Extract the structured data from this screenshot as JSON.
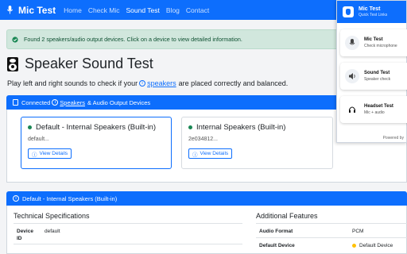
{
  "nav": {
    "brand": "Mic Test",
    "links": [
      {
        "label": "Home"
      },
      {
        "label": "Check Mic"
      },
      {
        "label": "Sound Test"
      },
      {
        "label": "Blog"
      },
      {
        "label": "Contact"
      }
    ],
    "active_index": 2
  },
  "alert": {
    "text": "Found 2 speakers/audio output devices. Click on a device to view detailed information."
  },
  "page": {
    "title": "Speaker Sound Test",
    "subtitle_before": "Play left and right sounds to check if your",
    "subtitle_link": "speakers",
    "subtitle_after": "are placed correctly and balanced."
  },
  "devices_panel": {
    "prefix": "Connected",
    "link": "Speakers",
    "suffix": "& Audio Output Devices",
    "devices": [
      {
        "name": "Default - Internal Speakers (Built-in)",
        "id": "default...",
        "button": "View Details"
      },
      {
        "name": "Internal Speakers (Built-in)",
        "id": "2e034812...",
        "button": "View Details"
      }
    ]
  },
  "detail_panel": {
    "title": "Default - Internal Speakers (Built-in)",
    "tech_title": "Technical Specifications",
    "features_title": "Additional Features",
    "device_id_label": "Device ID",
    "device_id_value": "default",
    "audio_format_label": "Audio Format",
    "audio_format_value": "PCM",
    "default_device_label": "Default Device",
    "default_device_value": "Default Device"
  },
  "extension": {
    "title": "Mic Test",
    "subtitle": "Quick Test Links",
    "items": [
      {
        "title": "Mic Test",
        "desc": "Check microphone",
        "icon": "microphone-icon"
      },
      {
        "title": "Sound Test",
        "desc": "Speaker check",
        "icon": "speaker-icon"
      },
      {
        "title": "Headset Test",
        "desc": "Mic + audio",
        "icon": "headphones-icon"
      }
    ],
    "footer": "Powered by"
  },
  "colors": {
    "primary": "#0d6efd",
    "success_bg": "#d1e7dd",
    "success_text": "#0f5132",
    "status_dot": "#198754",
    "warning_dot": "#ffc107"
  }
}
